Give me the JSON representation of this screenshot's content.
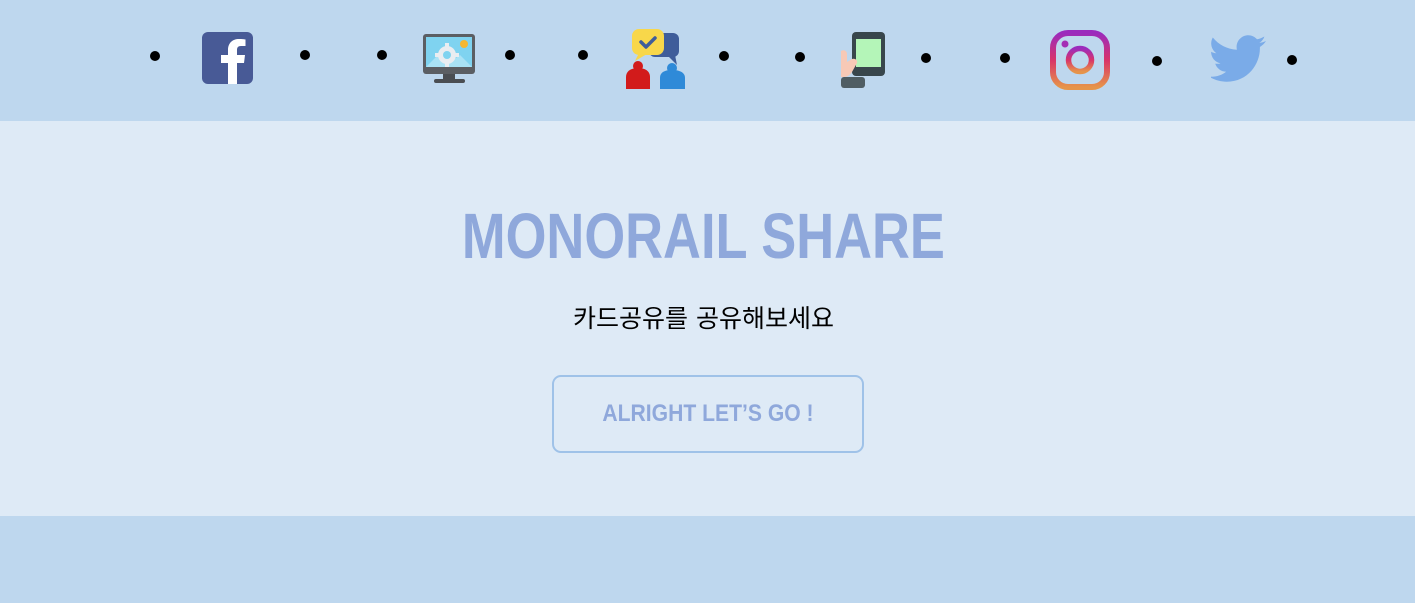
{
  "nav": {
    "icons": [
      "facebook-icon",
      "desktop-settings-icon",
      "chat-users-icon",
      "mobile-touch-icon",
      "instagram-icon",
      "twitter-icon"
    ]
  },
  "hero": {
    "title": "MONORAIL SHARE",
    "subtitle": "카드공유를 공유해보세요",
    "cta_label": "ALRIGHT LET’S GO !"
  },
  "colors": {
    "background": "#bed7ee",
    "hero_background": "#deeaf6",
    "accent": "#8fa8db",
    "button_border": "#9fc2e8"
  }
}
